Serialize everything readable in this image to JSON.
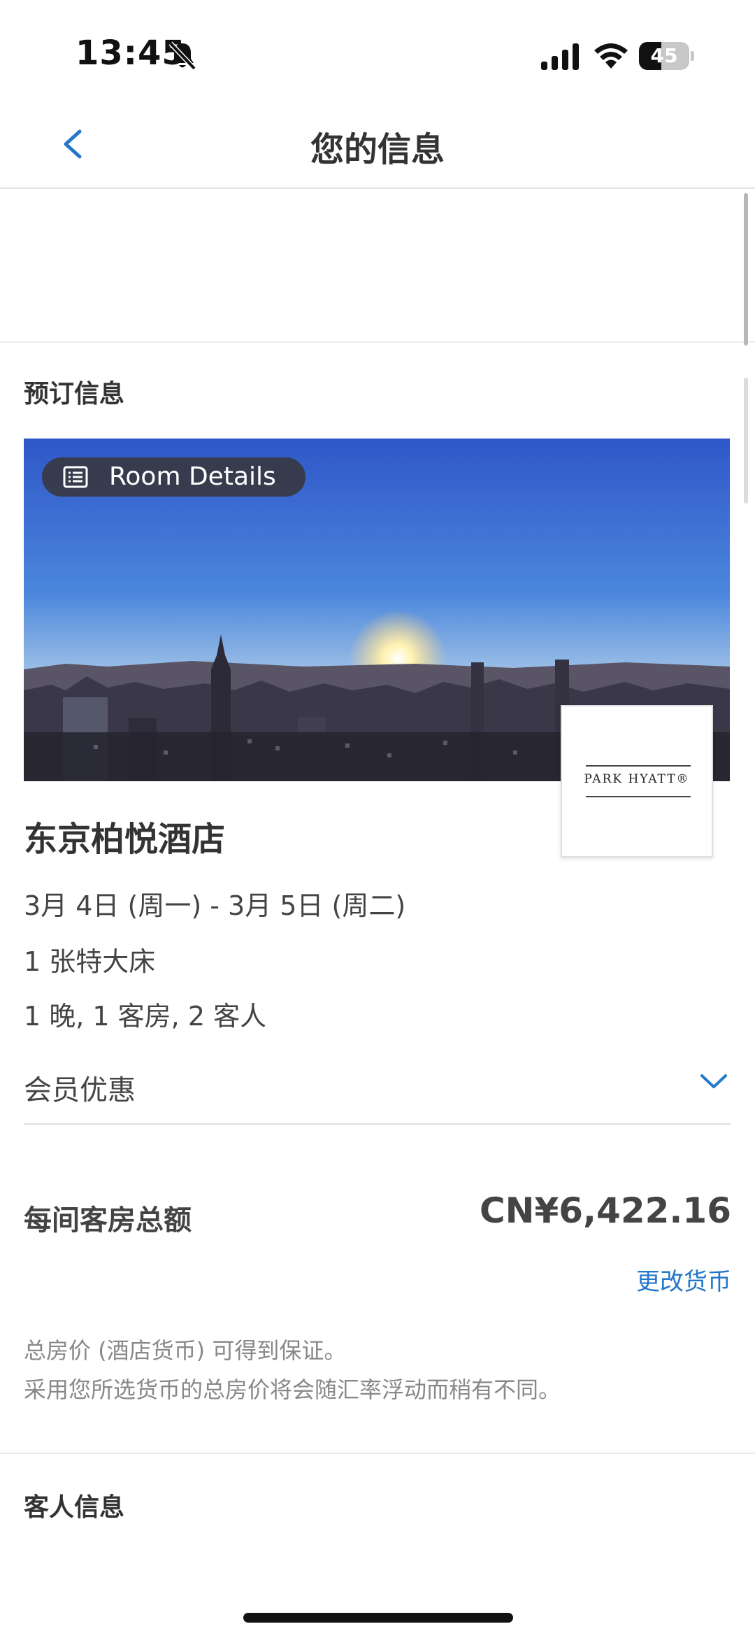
{
  "status_bar": {
    "time": "13:45",
    "battery_level": "45",
    "battery_fraction": 0.45,
    "icons": [
      "bell-muted-icon",
      "cellular-signal-icon",
      "wifi-icon",
      "battery-icon"
    ]
  },
  "header": {
    "title": "您的信息",
    "back_icon": "chevron-left-icon",
    "accent_color": "#2477c9"
  },
  "booking": {
    "section_title": "预订信息",
    "room_details_label": "Room Details",
    "room_details_icon": "list-icon",
    "brand_logo": "PARK HYATT®",
    "hotel_name": "东京柏悦酒店",
    "dates": "3月 4日 (周一) - 3月 5日 (周二)",
    "bed": "1 张特大床",
    "stay_summary": "1 晚, 1 客房, 2 客人",
    "member_benefits_label": "会员优惠",
    "member_benefits_icon": "chevron-down-icon"
  },
  "price": {
    "total_label": "每间客房总额",
    "total_value": "CN¥6,422.16",
    "change_currency_label": "更改货币",
    "note_line1": "总房价 (酒店货币) 可得到保证。",
    "note_line2": "采用您所选货币的总房价将会随汇率浮动而稍有不同。"
  },
  "guest": {
    "section_title": "客人信息"
  }
}
